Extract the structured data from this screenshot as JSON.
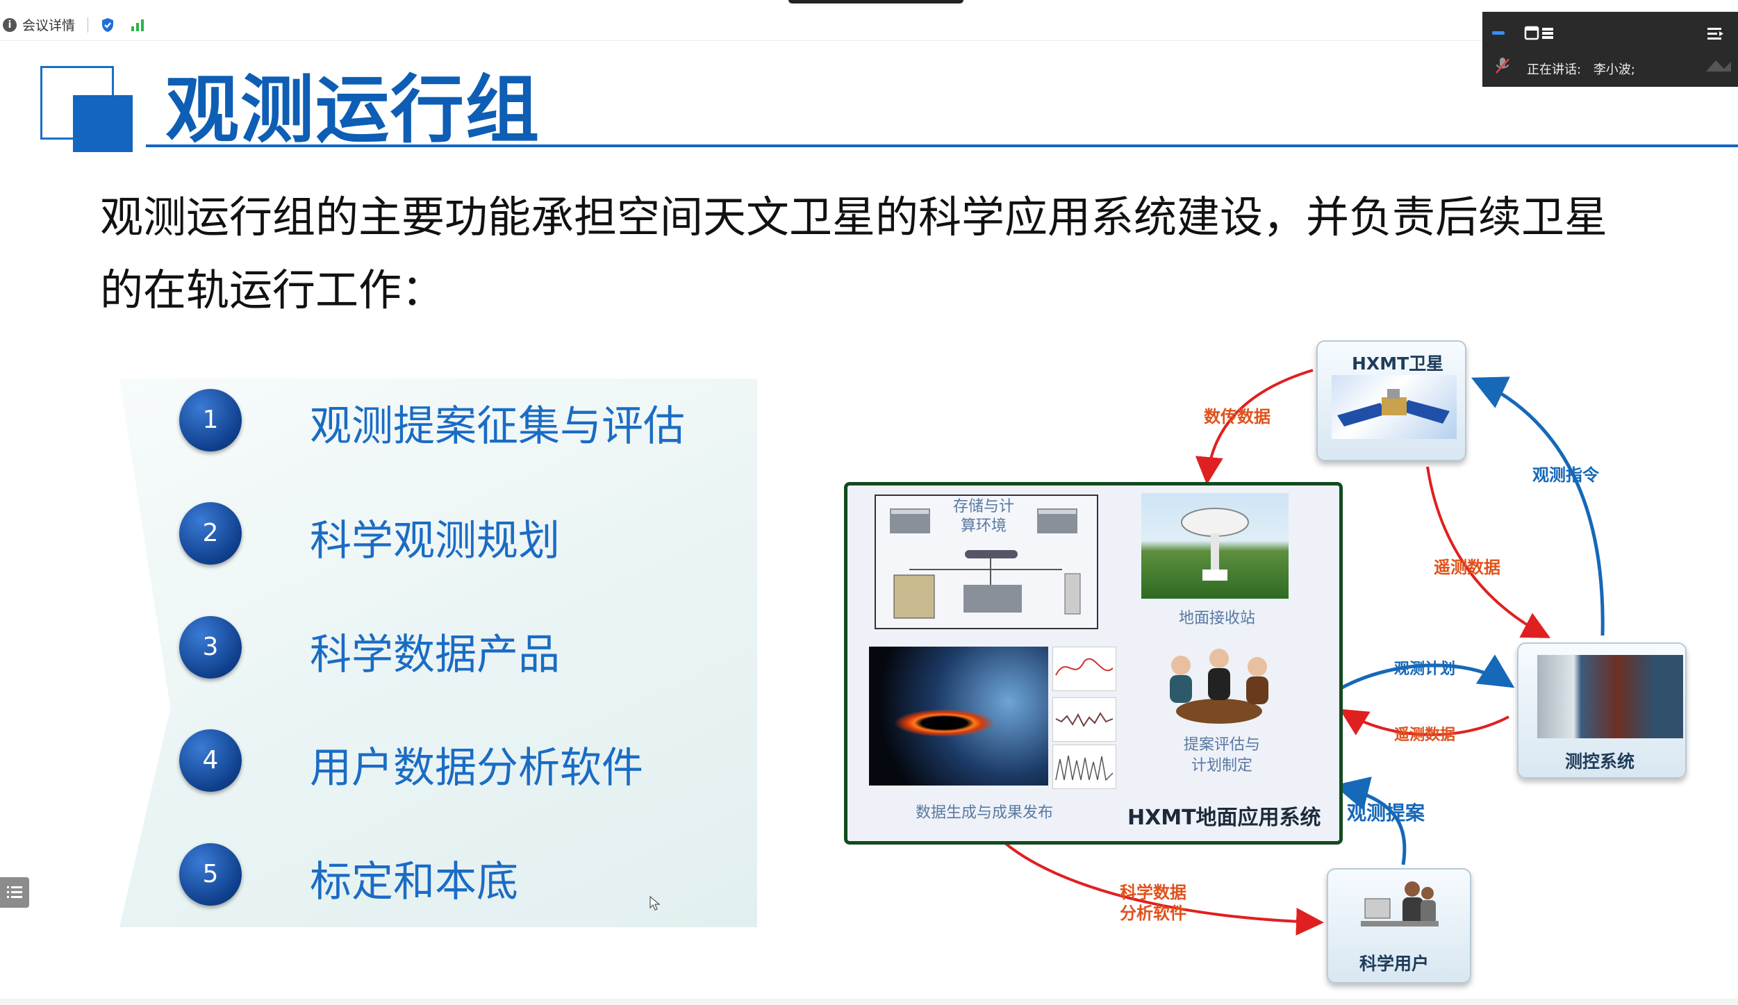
{
  "meeting": {
    "info_label": "会议详情",
    "speaking_label": "正在讲话:",
    "speaker_name": "李小波;"
  },
  "slide": {
    "title": "观测运行组",
    "intro": "观测运行组的主要功能承担空间天文卫星的科学应用系统建设，并负责后续卫星的在轨运行工作：",
    "items": [
      {
        "num": "1",
        "label": "观测提案征集与评估"
      },
      {
        "num": "2",
        "label": "科学观测规划"
      },
      {
        "num": "3",
        "label": "科学数据产品"
      },
      {
        "num": "4",
        "label": "用户数据分析软件"
      },
      {
        "num": "5",
        "label": "标定和本底"
      }
    ]
  },
  "diagram": {
    "satellite": "HXMT卫星",
    "ground_system": "HXMT地面应用系统",
    "storage": "存储与计算环境",
    "station": "地面接收站",
    "products": "数据生成与成果发布",
    "proposal_eval": "提案评估与计划制定",
    "control": "测控系统",
    "users": "科学用户",
    "flows": {
      "downlink": "数传数据",
      "command": "观测指令",
      "telemetry_sat": "遥测数据",
      "obs_plan": "观测计划",
      "telemetry_ctrl": "遥测数据",
      "proposal": "观测提案",
      "software": "科学数据分析软件"
    }
  },
  "colors": {
    "title_blue": "#0d5eb4",
    "list_blue": "#1a6cc4",
    "flow_red": "#e0521c",
    "flow_blue": "#1668b8",
    "ground_border": "#114a1f"
  }
}
